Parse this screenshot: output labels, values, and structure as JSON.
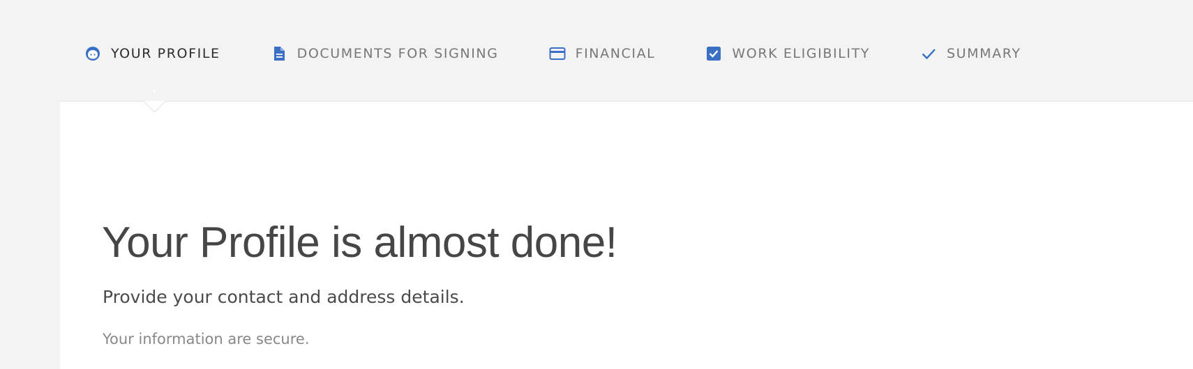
{
  "steps": [
    {
      "label": "YOUR PROFILE",
      "icon": "face-icon",
      "active": true
    },
    {
      "label": "DOCUMENTS FOR SIGNING",
      "icon": "document-icon",
      "active": false
    },
    {
      "label": "FINANCIAL",
      "icon": "credit-card-icon",
      "active": false
    },
    {
      "label": "WORK ELIGIBILITY",
      "icon": "checkbox-icon",
      "active": false
    },
    {
      "label": "SUMMARY",
      "icon": "checkmark-icon",
      "active": false
    }
  ],
  "main": {
    "heading": "Your Profile is almost done!",
    "subheading": "Provide your contact and address details.",
    "note": "Your information are secure."
  },
  "colors": {
    "accent": "#3a6fc4",
    "background": "#f3f3f3",
    "panel": "#ffffff",
    "active_text": "#2c2c2c",
    "inactive_text": "#777777"
  }
}
